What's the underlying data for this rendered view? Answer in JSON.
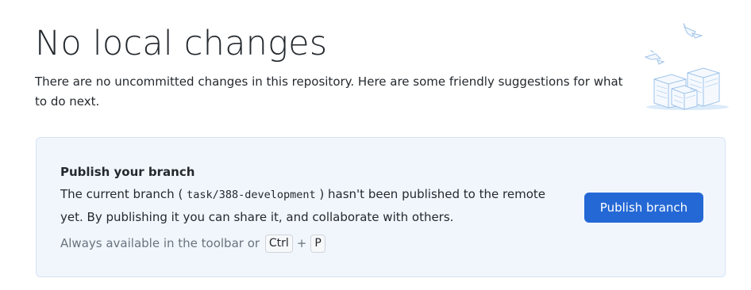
{
  "page": {
    "title": "No local changes",
    "description": "There are no uncommitted changes in this repository. Here are some friendly suggestions for what to do next."
  },
  "illustration": {
    "icon": "scattered-papers-illustration-icon",
    "color": "#c5dcf3"
  },
  "publish_card": {
    "title": "Publish your branch",
    "text_before": "The current branch ( ",
    "branch_name": "task/388-development",
    "text_after": " ) hasn't been published to the remote yet. By publishing it you can share it, and collaborate with others.",
    "hint_text": "Always available in the toolbar or",
    "shortcut_keys": [
      "Ctrl",
      "P"
    ],
    "shortcut_separator": "+",
    "button_label": "Publish branch",
    "background_color": "#f1f6fd",
    "button_color": "#2468d5"
  }
}
